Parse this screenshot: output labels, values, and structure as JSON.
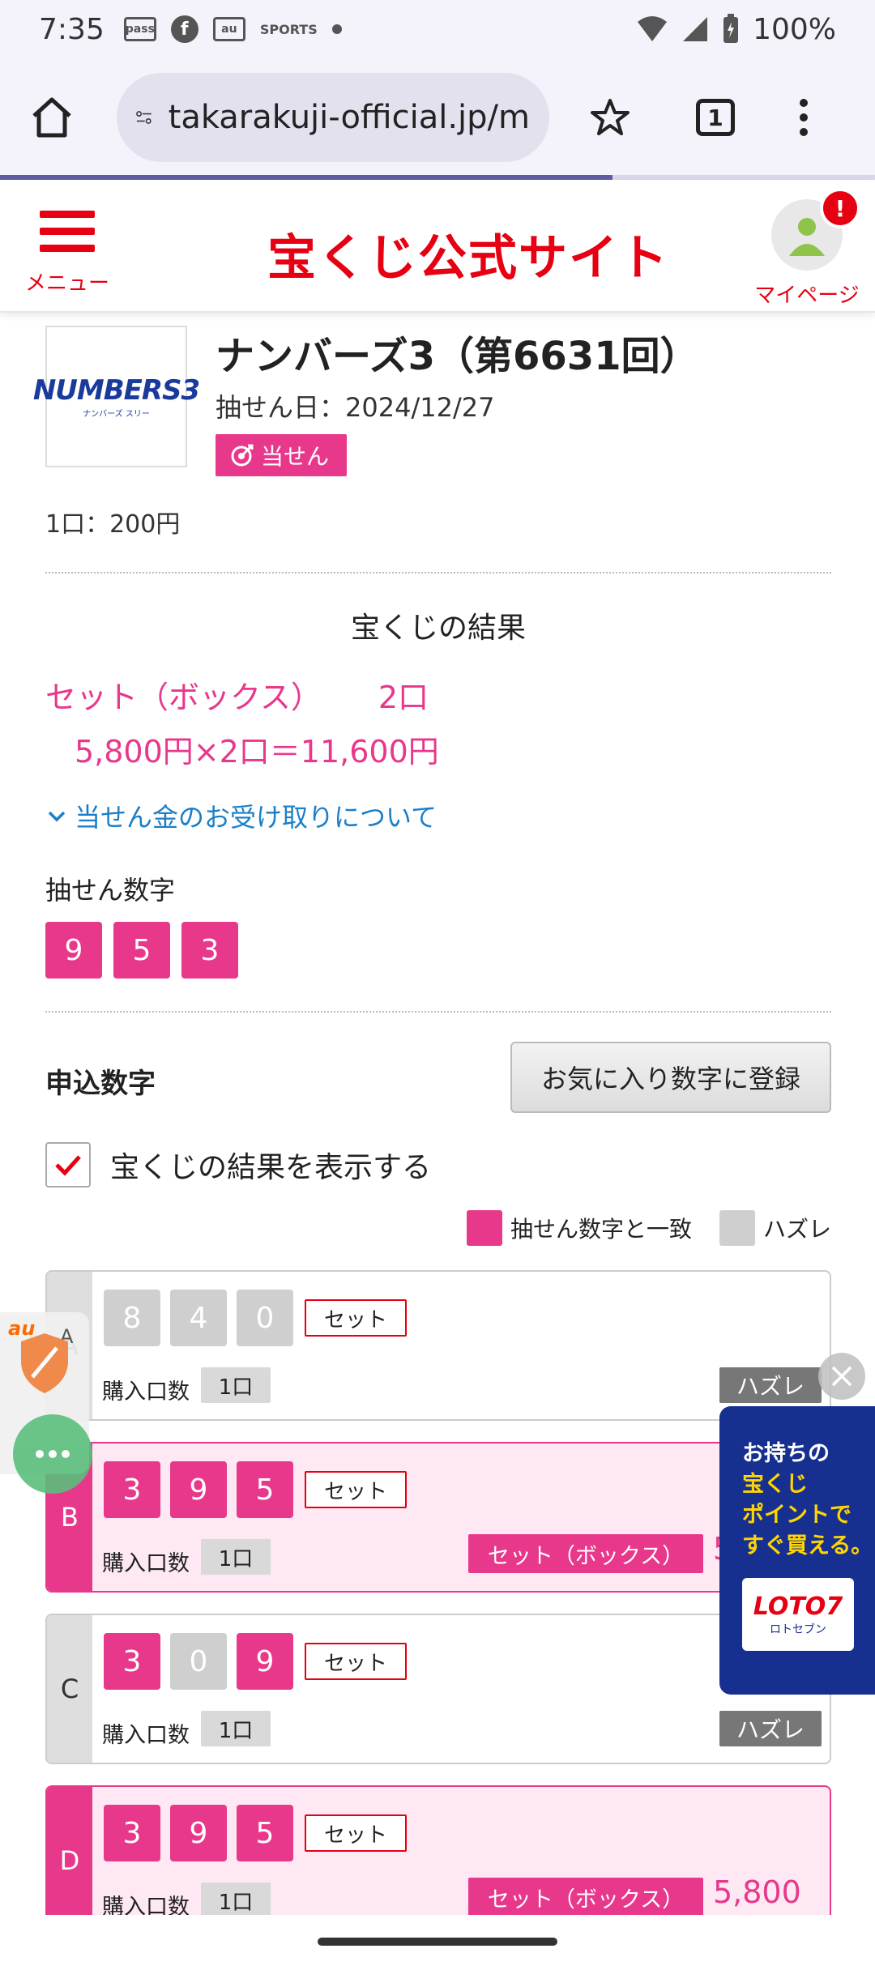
{
  "status_bar": {
    "time": "7:35",
    "battery": "100%",
    "icons": [
      "pass-icon",
      "facebook-icon",
      "au-icon",
      "sports-icon",
      "dot-icon",
      "wifi-icon",
      "signal-icon",
      "battery-icon"
    ]
  },
  "browser": {
    "url": "takarakuji-official.jp/m",
    "tab_count": "1",
    "load_progress": 0.7
  },
  "site": {
    "menu_label": "メニュー",
    "logo_text": "宝くじ公式サイト",
    "mypage_label": "マイページ",
    "alert_badge": "!"
  },
  "lottery": {
    "logo_text": "NUMBERS3",
    "logo_sub": "ナンバーズ スリー",
    "title": "ナンバーズ3（第6631回）",
    "draw_date": "抽せん日：2024/12/27",
    "win_badge": "当せん",
    "unit_price": "1口：200円"
  },
  "result": {
    "section_title": "宝くじの結果",
    "line1_type": "セット（ボックス）",
    "line1_count": "2口",
    "line2": "5,800円×2口＝11,600円",
    "prize_link": "当せん金のお受け取りについて"
  },
  "draw": {
    "label": "抽せん数字",
    "numbers": [
      "9",
      "5",
      "3"
    ]
  },
  "apply": {
    "label": "申込数字",
    "fav_button": "お気に入り数字に登録",
    "show_result_label": "宝くじの結果を表示する",
    "show_result_checked": true
  },
  "legend": {
    "match": "抽せん数字と一致",
    "miss": "ハズレ"
  },
  "tickets": [
    {
      "letter": "A",
      "numbers": [
        "8",
        "4",
        "0"
      ],
      "hits": [
        false,
        false,
        false
      ],
      "set_label": "セット",
      "qty_label": "購入口数",
      "qty": "1口",
      "result": "ハズレ"
    },
    {
      "letter": "B",
      "numbers": [
        "3",
        "9",
        "5"
      ],
      "hits": [
        true,
        true,
        true
      ],
      "set_label": "セット",
      "qty_label": "購入口数",
      "qty": "1口",
      "result": "セット（ボックス）",
      "amount": "5"
    },
    {
      "letter": "C",
      "numbers": [
        "3",
        "0",
        "9"
      ],
      "hits": [
        true,
        false,
        true
      ],
      "set_label": "セット",
      "qty_label": "購入口数",
      "qty": "1口",
      "result": "ハズレ"
    },
    {
      "letter": "D",
      "numbers": [
        "3",
        "9",
        "5"
      ],
      "hits": [
        true,
        true,
        true
      ],
      "set_label": "セット",
      "qty_label": "購入口数",
      "qty": "1口",
      "result": "セット（ボックス）",
      "amount": "5,800円"
    }
  ],
  "overlays": {
    "au_label": "au",
    "au_letter": "A",
    "ad_line1": "お持ちの",
    "ad_line2": "宝くじ",
    "ad_line3": "ポイントで",
    "ad_line4": "すぐ買える。",
    "ad_logo": "LOTO7",
    "ad_logo_sub": "ロトセブン"
  }
}
